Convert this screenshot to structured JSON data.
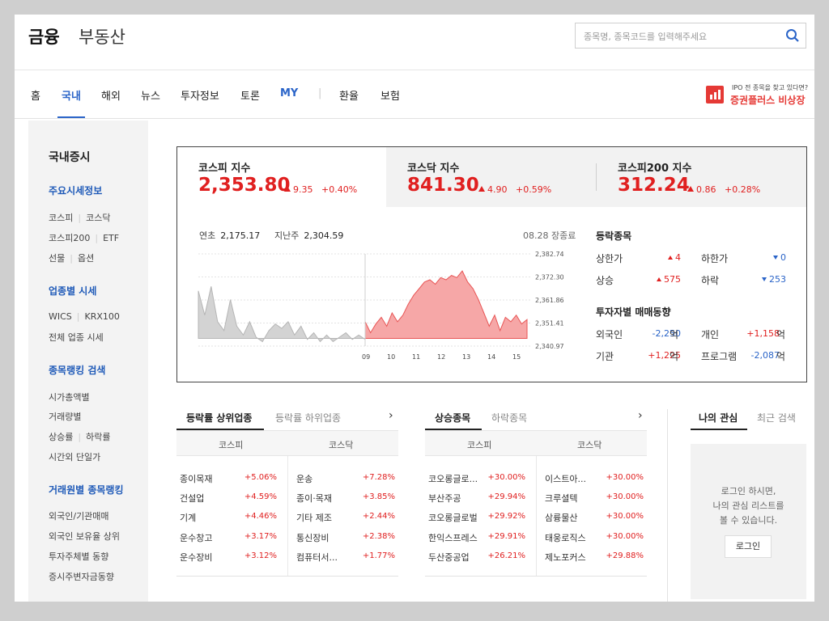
{
  "header": {
    "logo_finance": "금융",
    "logo_realestate": "부동산",
    "search_placeholder": "종목명, 종목코드를 입력해주세요"
  },
  "nav": {
    "items": [
      "홈",
      "국내",
      "해외",
      "뉴스",
      "투자정보",
      "토론",
      "MY",
      "환율",
      "보험"
    ],
    "active": "국내"
  },
  "ad": {
    "line1": "IPO 전 종목을 찾고 있다면?",
    "line2": "증권플러스 비상장"
  },
  "sidebar": {
    "title": "국내증시",
    "sections": [
      {
        "head": "주요시세정보",
        "items": [
          [
            "코스피",
            "코스닥"
          ],
          [
            "코스피200",
            "ETF"
          ],
          [
            "선물",
            "옵션"
          ]
        ]
      },
      {
        "head": "업종별 시세",
        "items": [
          [
            "WICS",
            "KRX100"
          ],
          [
            "전체 업종 시세"
          ]
        ]
      },
      {
        "head": "종목랭킹 검색",
        "items": [
          [
            "시가총액별"
          ],
          [
            "거래량별"
          ],
          [
            "상승률",
            "하락률"
          ],
          [
            "시간외 단일가"
          ]
        ]
      },
      {
        "head": "거래원별 종목랭킹",
        "items": [
          [
            "외국인/기관매매"
          ],
          [
            "외국인 보유율 상위"
          ],
          [
            "투자주체별 동향"
          ],
          [
            "증시주변자금동향"
          ]
        ]
      }
    ]
  },
  "indices": [
    {
      "name": "코스피 지수",
      "value": "2,353.80",
      "change": "9.35",
      "pct": "+0.40%"
    },
    {
      "name": "코스닥 지수",
      "value": "841.30",
      "change": "4.90",
      "pct": "+0.59%"
    },
    {
      "name": "코스피200 지수",
      "value": "312.24",
      "change": "0.86",
      "pct": "+0.28%"
    }
  ],
  "chart_info": {
    "ytd_label": "연초",
    "ytd_value": "2,175.17",
    "lastweek_label": "지난주",
    "lastweek_value": "2,304.59",
    "status": "08.28 장종료"
  },
  "chart_data": {
    "type": "area",
    "y_ticks": [
      "2,382.74",
      "2,372.30",
      "2,361.86",
      "2,351.41",
      "2,340.97"
    ],
    "ylim": [
      2340.97,
      2382.74
    ],
    "x_ticks": [
      "09",
      "10",
      "11",
      "12",
      "13",
      "14",
      "15"
    ],
    "reference_level": 2344.45,
    "prior_day": [
      2366,
      2355,
      2368,
      2352,
      2348,
      2362,
      2350,
      2346,
      2352,
      2345,
      2343,
      2348,
      2351,
      2349,
      2352,
      2346,
      2350,
      2344,
      2347,
      2343,
      2346,
      2343,
      2345,
      2347,
      2344,
      2346,
      2344
    ],
    "today": [
      2352,
      2347,
      2351,
      2354,
      2350,
      2356,
      2352,
      2355,
      2360,
      2364,
      2367,
      2370,
      2371,
      2369,
      2372,
      2371,
      2373,
      2372,
      2375,
      2370,
      2367,
      2362,
      2356,
      2350,
      2355,
      2348,
      2354,
      2352,
      2355,
      2351,
      2353
    ],
    "series_colors": {
      "prior": "#d3d3d3",
      "today": "#f6a7a7"
    }
  },
  "updown": {
    "title": "등락종목",
    "upper_label": "상한가",
    "upper_value": "4",
    "lower_label": "하한가",
    "lower_value": "0",
    "rise_label": "상승",
    "rise_value": "575",
    "fall_label": "하락",
    "fall_value": "253"
  },
  "investors": {
    "title": "투자자별 매매동향",
    "foreign_label": "외국인",
    "foreign_value": "-2,250",
    "personal_label": "개인",
    "personal_value": "+1,158",
    "inst_label": "기관",
    "inst_value": "+1,225",
    "program_label": "프로그램",
    "program_value": "-2,087",
    "unit": "억"
  },
  "sector_panel": {
    "tab_active": "등락률 상위업종",
    "tab_inactive": "등락률 하위업종",
    "col_left": "코스피",
    "col_right": "코스닥",
    "left_rows": [
      [
        "종이목재",
        "+5.06%"
      ],
      [
        "건설업",
        "+4.59%"
      ],
      [
        "기계",
        "+4.46%"
      ],
      [
        "운수창고",
        "+3.17%"
      ],
      [
        "운수장비",
        "+3.12%"
      ]
    ],
    "right_rows": [
      [
        "운송",
        "+7.28%"
      ],
      [
        "종이·목재",
        "+3.85%"
      ],
      [
        "기타 제조",
        "+2.44%"
      ],
      [
        "통신장비",
        "+2.38%"
      ],
      [
        "컴퓨터서...",
        "+1.77%"
      ]
    ]
  },
  "stock_panel": {
    "tab_active": "상승종목",
    "tab_inactive": "하락종목",
    "col_left": "코스피",
    "col_right": "코스닥",
    "left_rows": [
      [
        "코오롱글로...",
        "+30.00%"
      ],
      [
        "부산주공",
        "+29.94%"
      ],
      [
        "코오롱글로벌",
        "+29.92%"
      ],
      [
        "한익스프레스",
        "+29.91%"
      ],
      [
        "두산중공업",
        "+26.21%"
      ]
    ],
    "right_rows": [
      [
        "이스트아...",
        "+30.00%"
      ],
      [
        "크루셜텍",
        "+30.00%"
      ],
      [
        "삼륭물산",
        "+30.00%"
      ],
      [
        "태웅로직스",
        "+30.00%"
      ],
      [
        "제노포커스",
        "+29.88%"
      ]
    ]
  },
  "interest_panel": {
    "tab_active": "나의 관심",
    "tab_inactive": "최근 검색",
    "message": "로그인 하시면,\n나의 관심 리스트를\n볼 수 있습니다.",
    "login_label": "로그인"
  }
}
